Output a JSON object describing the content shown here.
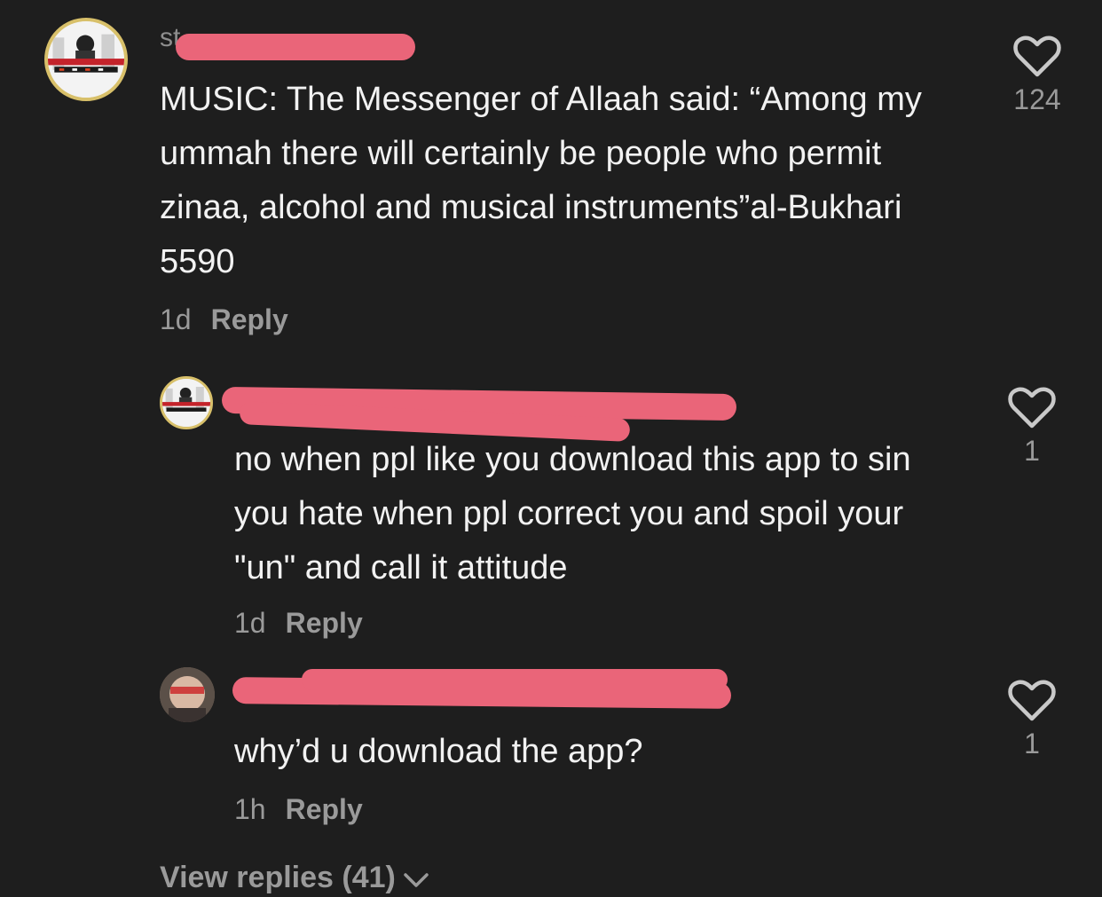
{
  "comment": {
    "username": "st",
    "text": "MUSIC: The Messenger of Allaah said: “Among my ummah there will certainly be people who permit zinaa, alcohol and musical instruments”al-Bukhari 5590",
    "time": "1d",
    "reply_label": "Reply",
    "likes": "124"
  },
  "replies": [
    {
      "text": "no when ppl like you download this app to sin you hate when ppl correct you and spoil your \"un\" and call it attitude",
      "time": "1d",
      "reply_label": "Reply",
      "likes": "1"
    },
    {
      "text": "why’d u download the app?",
      "time": "1h",
      "reply_label": "Reply",
      "likes": "1"
    }
  ],
  "view_replies_label": "View replies (41)",
  "colors": {
    "background": "#1e1e1e",
    "redaction": "#ea6579",
    "muted": "#9a9a9a"
  }
}
